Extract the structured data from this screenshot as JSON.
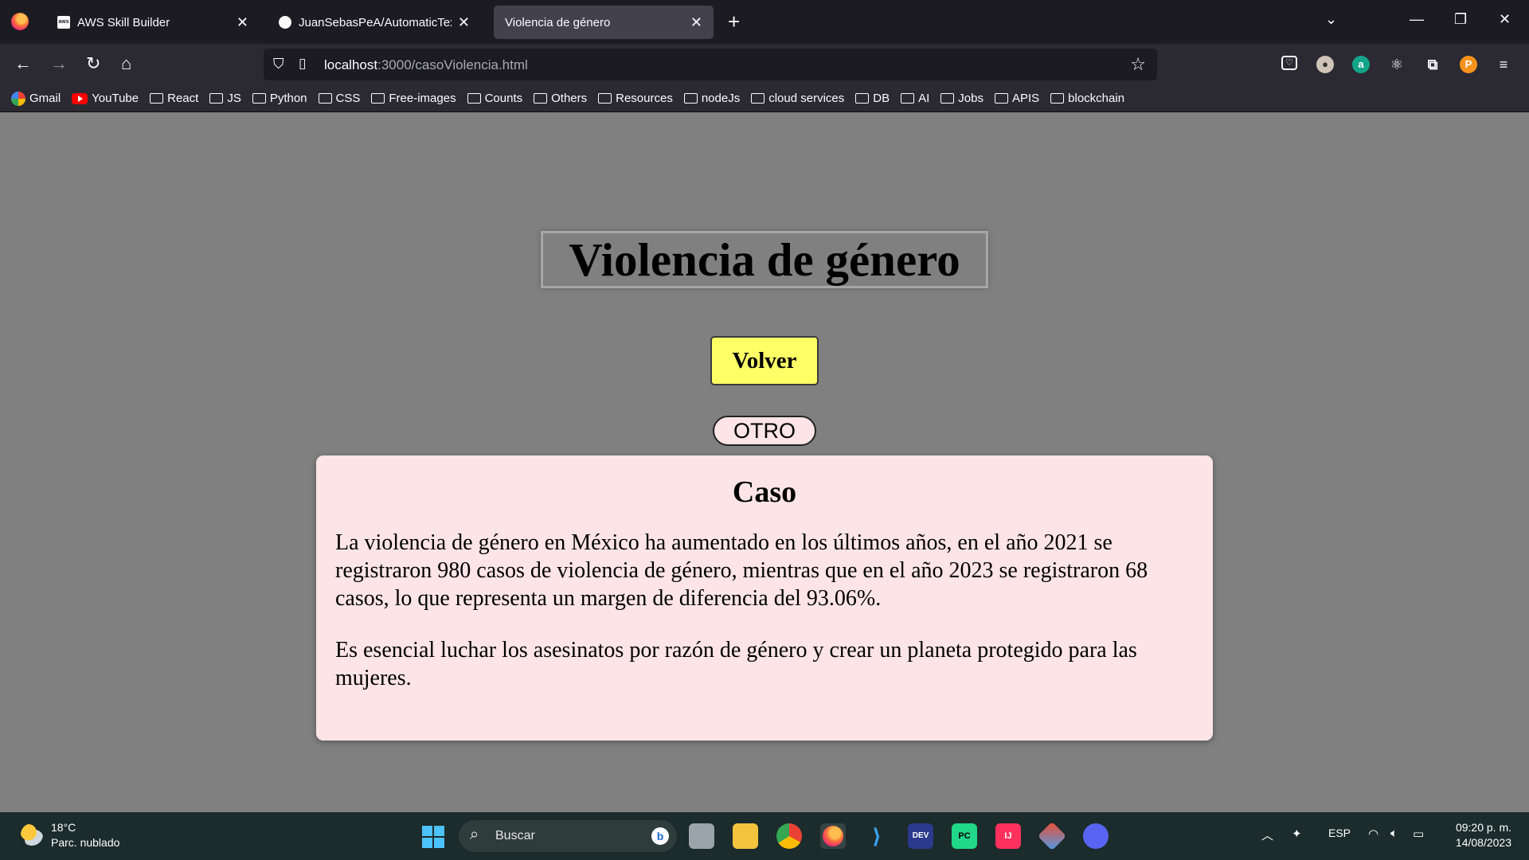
{
  "browser": {
    "tabs": [
      {
        "title": "AWS Skill Builder",
        "favicon": "aws-icon",
        "active": false
      },
      {
        "title": "JuanSebasPeA/AutomaticTextG",
        "favicon": "github-icon",
        "active": false
      },
      {
        "title": "Violencia de género",
        "favicon": "",
        "active": true
      }
    ],
    "url": {
      "host": "localhost",
      "path": ":3000/casoViolencia.html"
    },
    "bookmarks": [
      "Gmail",
      "YouTube",
      "React",
      "JS",
      "Python",
      "CSS",
      "Free-images",
      "Counts",
      "Others",
      "Resources",
      "nodeJs",
      "cloud services",
      "DB",
      "AI",
      "Jobs",
      "APIS",
      "blockchain"
    ]
  },
  "page": {
    "title": "Violencia de género",
    "back_button": "Volver",
    "other_button": "OTRO",
    "card": {
      "heading": "Caso",
      "paragraphs": [
        "La violencia de género en México ha aumentado en los últimos años, en el año 2021 se registraron 980 casos de violencia de género, mientras que en el año 2023 se registraron 68 casos, lo que representa un margen de diferencia del 93.06%.",
        "Es esencial luchar los asesinatos por razón de género y crear un planeta protegido para las mujeres."
      ]
    },
    "colors": {
      "background": "#808080",
      "volver": "#ffff66",
      "card": "#fde4e6"
    }
  },
  "taskbar": {
    "weather": {
      "temp": "18°C",
      "desc": "Parc. nublado"
    },
    "search_placeholder": "Buscar",
    "language": "ESP",
    "time": "09:20 p. m.",
    "date": "14/08/2023"
  }
}
